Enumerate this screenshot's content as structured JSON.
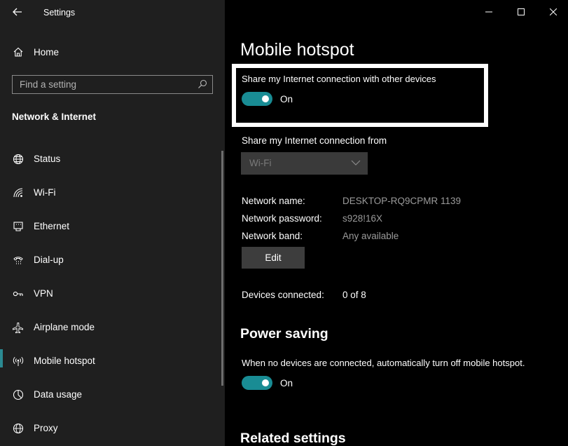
{
  "window": {
    "title": "Settings"
  },
  "sidebar": {
    "home_label": "Home",
    "search_placeholder": "Find a setting",
    "section_title": "Network & Internet",
    "items": [
      {
        "label": "Status",
        "icon": "globe-icon"
      },
      {
        "label": "Wi-Fi",
        "icon": "wifi-icon"
      },
      {
        "label": "Ethernet",
        "icon": "ethernet-icon"
      },
      {
        "label": "Dial-up",
        "icon": "dialup-icon"
      },
      {
        "label": "VPN",
        "icon": "vpn-icon"
      },
      {
        "label": "Airplane mode",
        "icon": "airplane-icon"
      },
      {
        "label": "Mobile hotspot",
        "icon": "hotspot-icon",
        "selected": true
      },
      {
        "label": "Data usage",
        "icon": "data-usage-icon"
      },
      {
        "label": "Proxy",
        "icon": "globe-icon"
      }
    ]
  },
  "main": {
    "title": "Mobile hotspot",
    "share_label": "Share my Internet connection with other devices",
    "share_toggle_text": "On",
    "share_from_label": "Share my Internet connection from",
    "share_from_value": "Wi-Fi",
    "network_name_label": "Network name:",
    "network_name_value": "DESKTOP-RQ9CPMR 1139",
    "network_password_label": "Network password:",
    "network_password_value": "s928!16X",
    "network_band_label": "Network band:",
    "network_band_value": "Any available",
    "edit_label": "Edit",
    "devices_label": "Devices connected:",
    "devices_value": "0 of 8",
    "power_title": "Power saving",
    "power_desc": "When no devices are connected, automatically turn off mobile hotspot.",
    "power_toggle_text": "On",
    "related_title": "Related settings"
  },
  "colors": {
    "accent": "#198c94",
    "sidebar_bg": "#1f1f1f",
    "main_bg": "#000000"
  }
}
